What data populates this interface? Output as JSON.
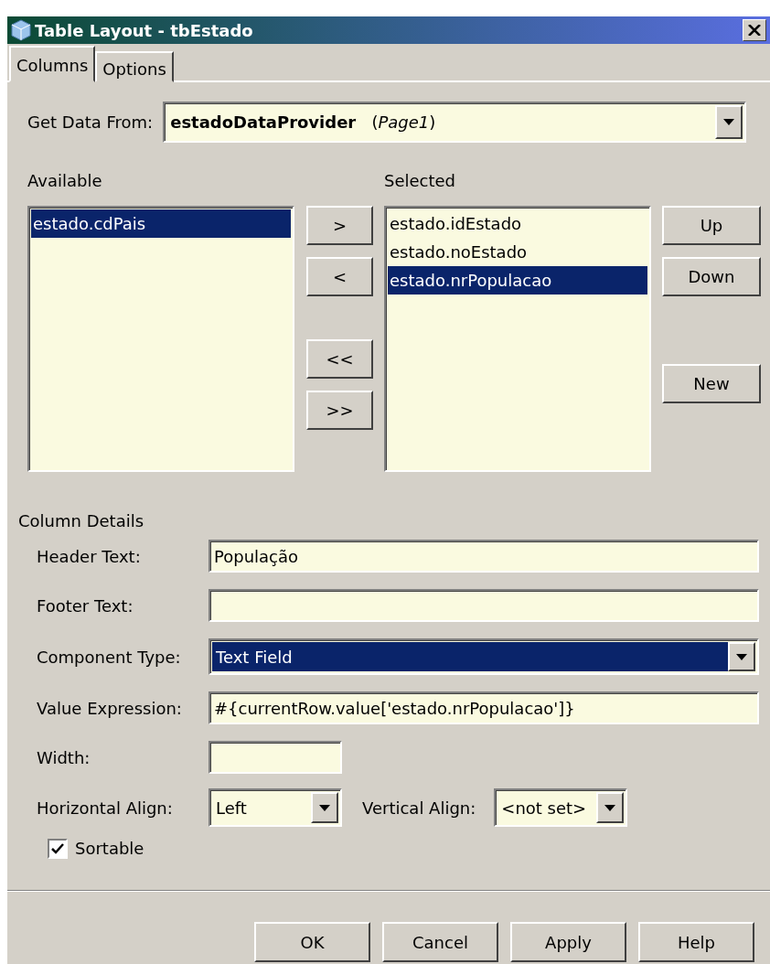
{
  "window": {
    "title": "Table Layout - tbEstado"
  },
  "tabs": [
    {
      "label": "Columns",
      "selected": true
    },
    {
      "label": "Options",
      "selected": false
    }
  ],
  "get_data_from": {
    "label": "Get Data From:",
    "value": "**estadoDataProvider**   (*Page1*)"
  },
  "available": {
    "label": "Available",
    "items": [
      {
        "text": "estado.cdPais",
        "selected": true
      }
    ]
  },
  "move_buttons": [
    ">",
    "<",
    "<<",
    ">>"
  ],
  "selected_columns": {
    "label": "Selected",
    "items": [
      {
        "text": "estado.idEstado",
        "selected": false
      },
      {
        "text": "estado.noEstado",
        "selected": false
      },
      {
        "text": "estado.nrPopulacao",
        "selected": true
      }
    ]
  },
  "order_buttons": [
    "Up",
    "Down",
    "New"
  ],
  "column_details": {
    "title": "Column Details",
    "fields": [
      {
        "kind": "text",
        "label": "Header Text:",
        "value": "População"
      },
      {
        "kind": "text",
        "label": "Footer Text:"
      },
      {
        "kind": "combo",
        "label": "Component Type:",
        "value": "Text Field",
        "selected": true
      },
      {
        "kind": "text",
        "label": "Value Expression:",
        "value": "#{currentRow.value['estado.nrPopulacao']}"
      },
      {
        "kind": "short",
        "label": "Width:"
      }
    ],
    "alignment": [
      {
        "label": "Horizontal Align:",
        "value": "Left"
      },
      {
        "label": "Vertical Align:",
        "value": "<not set>"
      }
    ],
    "sortable": {
      "label": "Sortable",
      "checked": true
    }
  },
  "buttons": [
    "OK",
    "Cancel",
    "Apply",
    "Help"
  ]
}
